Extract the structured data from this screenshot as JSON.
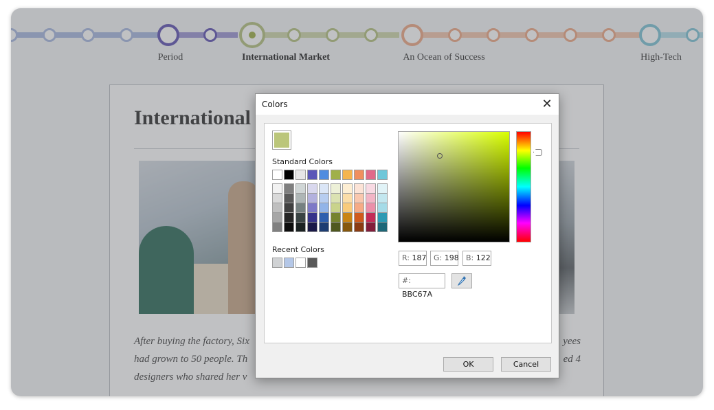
{
  "timeline": {
    "labels": {
      "period": "Period",
      "international_market": "International Market",
      "ocean_of_success": "An Ocean of Success",
      "high_tech": "High-Tech"
    },
    "colors": {
      "blue": "#a8b9e0",
      "purple": "#6255b4",
      "purple_seg": "#9d96d4",
      "green": "#b5c282",
      "green_seg": "#cfd7ab",
      "orange": "#eda986",
      "orange_seg": "#f3c6ad",
      "teal": "#7ec4d6",
      "teal_seg": "#b3dde8"
    }
  },
  "article": {
    "heading": "International",
    "paragraph_lines": [
      "After buying the factory, Six",
      "yees",
      "had grown to 50 people. Th",
      "ed 4",
      "designers who shared her v"
    ]
  },
  "dialog": {
    "title": "Colors",
    "close_glyph": "✕",
    "current_color": "#BBC67A",
    "standard_colors_label": "Standard Colors",
    "recent_colors_label": "Recent Colors",
    "standard_top_row": [
      "#ffffff",
      "#000000",
      "#e7e6e6",
      "#5a57b8",
      "#4f8ce0",
      "#a0b04a",
      "#f5b54e",
      "#f08f5e",
      "#e06a8a",
      "#6fc7d9"
    ],
    "standard_shades": [
      [
        "#f2f2f2",
        "#d9d9d9",
        "#bfbfbf",
        "#a6a6a6",
        "#808080"
      ],
      [
        "#7f7f7f",
        "#595959",
        "#404040",
        "#262626",
        "#0d0d0d"
      ],
      [
        "#d0d6d6",
        "#aeb6b6",
        "#768181",
        "#3a4444",
        "#1b2222"
      ],
      [
        "#d9d8ee",
        "#b3b1de",
        "#7d79c7",
        "#36338a",
        "#1a1947"
      ],
      [
        "#dbe6f7",
        "#b7cdf0",
        "#92b4e8",
        "#2e5fae",
        "#1d3d72"
      ],
      [
        "#edf0d8",
        "#dbe2b2",
        "#c9d38b",
        "#76832f",
        "#4f581f"
      ],
      [
        "#fdeed3",
        "#fbdda8",
        "#f9cb7c",
        "#c98414",
        "#86580d"
      ],
      [
        "#fce3d6",
        "#f9c7ae",
        "#f6ab86",
        "#d05a1c",
        "#8b3c13"
      ],
      [
        "#f8dae3",
        "#f2b5c6",
        "#eb90aa",
        "#c32c57",
        "#821d3a"
      ],
      [
        "#e1f3f7",
        "#c3e7ef",
        "#a5dbe7",
        "#2d9ab3",
        "#1e6777"
      ]
    ],
    "recent_colors": [
      "#d0d2d4",
      "#b4c7e7",
      "#ffffff",
      "#595959"
    ],
    "hue_base": "#d9ff00",
    "picker_position": {
      "saturation": 0.37,
      "value": 0.22
    },
    "hue_position": 0.19,
    "rgb": {
      "r_label": "R:",
      "r_value": "187",
      "g_label": "G:",
      "g_value": "198",
      "b_label": "B:",
      "b_value": "122"
    },
    "hex_label": "#:",
    "hex_value": "BBC67A",
    "ok_label": "OK",
    "cancel_label": "Cancel"
  }
}
